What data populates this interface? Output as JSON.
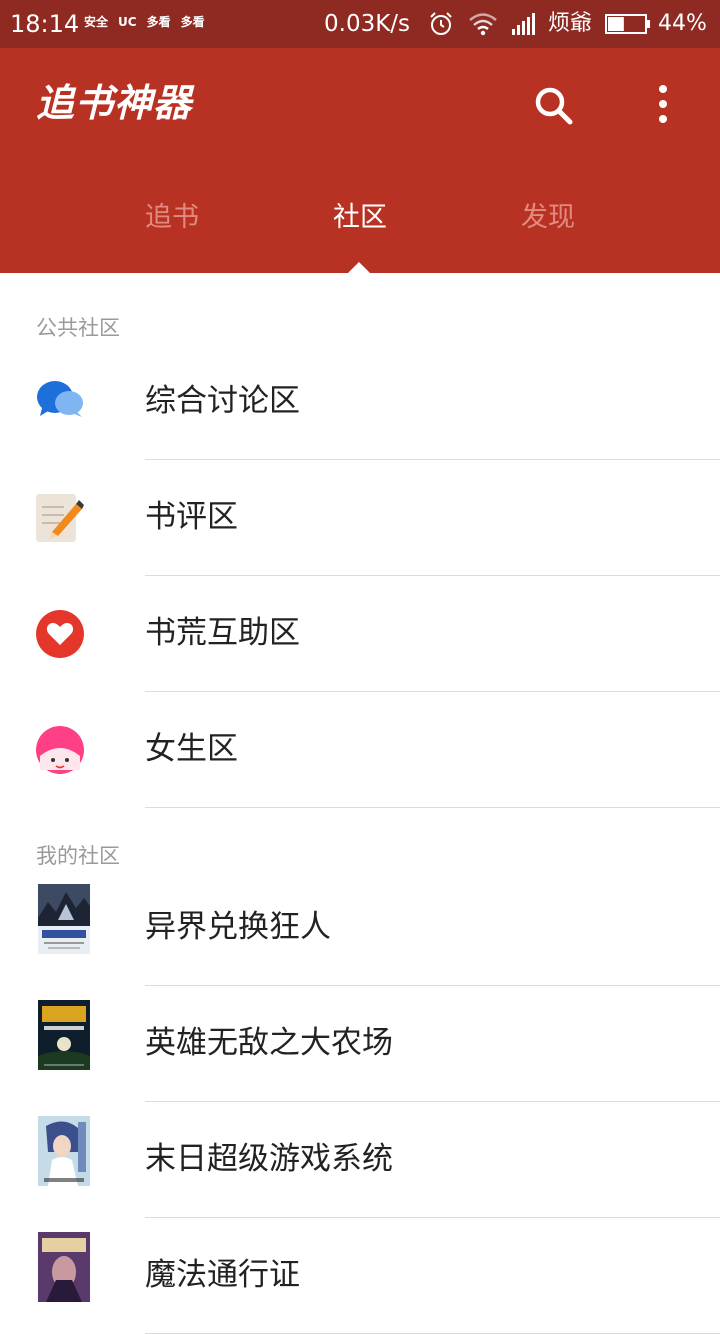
{
  "status_bar": {
    "time": "18:14",
    "notifications": [
      "安全",
      "UC",
      "多看",
      "多看"
    ],
    "net_speed": "0.03K/s",
    "carrier": "烦爺",
    "battery": "44%",
    "battery_level": 0.44
  },
  "app_bar": {
    "title": "追书神器",
    "tabs": [
      {
        "label": "追书",
        "active": false
      },
      {
        "label": "社区",
        "active": true
      },
      {
        "label": "发现",
        "active": false
      }
    ],
    "accent_color": "#b83223"
  },
  "public_section": {
    "header": "公共社区",
    "items": [
      {
        "label": "综合讨论区",
        "icon": "chat-bubbles-icon"
      },
      {
        "label": "书评区",
        "icon": "notepad-pencil-icon"
      },
      {
        "label": "书荒互助区",
        "icon": "heart-icon"
      },
      {
        "label": "女生区",
        "icon": "girl-face-icon"
      }
    ]
  },
  "my_section": {
    "header": "我的社区",
    "items": [
      {
        "label": "异界兑换狂人"
      },
      {
        "label": "英雄无敌之大农场"
      },
      {
        "label": "末日超级游戏系统"
      },
      {
        "label": "魔法通行证"
      }
    ]
  }
}
